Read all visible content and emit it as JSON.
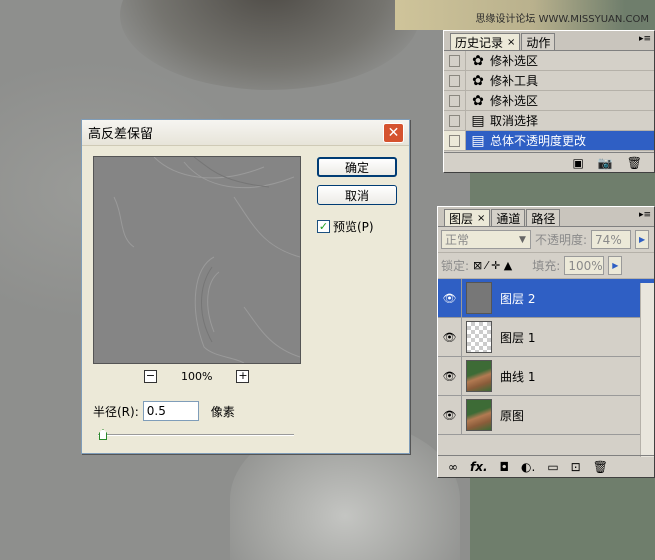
{
  "watermark": "思缘设计论坛 WWW.MISSYUAN.COM",
  "dialog": {
    "title": "高反差保留",
    "ok_label": "确定",
    "cancel_label": "取消",
    "preview_label": "预览(P)",
    "preview_checked": true,
    "zoom_level": "100%",
    "zoom_out": "−",
    "zoom_in": "+",
    "radius_label": "半径(R):",
    "radius_value": "0.5",
    "radius_unit": "像素",
    "close_glyph": "✕"
  },
  "history": {
    "tabs": [
      {
        "label": "历史记录",
        "close": "×",
        "active": true
      },
      {
        "label": "动作",
        "active": false
      }
    ],
    "menu_glyph": "▸≡",
    "items": [
      {
        "label": "修补选区",
        "icon": "patch-icon",
        "glyph": "✿"
      },
      {
        "label": "修补工具",
        "icon": "patch-icon",
        "glyph": "✿"
      },
      {
        "label": "修补选区",
        "icon": "patch-icon",
        "glyph": "✿"
      },
      {
        "label": "取消选择",
        "icon": "document-icon",
        "glyph": "▤"
      },
      {
        "label": "总体不透明度更改",
        "icon": "document-icon",
        "glyph": "▤",
        "selected": true
      }
    ],
    "footer_icons": [
      "▣",
      "📷",
      "🗑"
    ]
  },
  "layers": {
    "tabs": [
      {
        "label": "图层",
        "close": "×",
        "active": true
      },
      {
        "label": "通道",
        "active": false
      },
      {
        "label": "路径",
        "active": false
      }
    ],
    "menu_glyph": "▸≡",
    "blend_mode": "正常",
    "opacity_label": "不透明度:",
    "opacity_value": "74%",
    "lock_label": "锁定:",
    "lock_icons": "⊠ ⁄ ✛ ▲",
    "fill_label": "填充:",
    "fill_value": "100%",
    "items": [
      {
        "name": "图层 2",
        "thumb": "gray",
        "selected": true
      },
      {
        "name": "图层 1",
        "thumb": "transparent"
      },
      {
        "name": "曲线 1",
        "thumb": "photo"
      },
      {
        "name": "原图",
        "thumb": "photo"
      }
    ],
    "eye_glyph": "👁",
    "footer_icons": [
      "∞",
      "fx.",
      "◘",
      "◐.",
      "▭",
      "⊡",
      "🗑"
    ]
  }
}
